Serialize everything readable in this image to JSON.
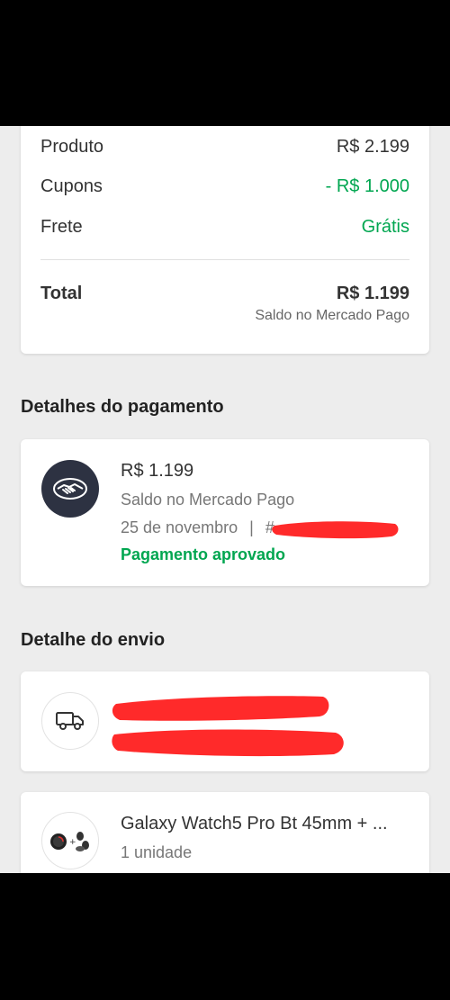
{
  "summary": {
    "product_label": "Produto",
    "product_value": "R$ 2.199",
    "coupons_label": "Cupons",
    "coupons_value": "- R$ 1.000",
    "shipping_label": "Frete",
    "shipping_value": "Grátis",
    "total_label": "Total",
    "total_value": "R$ 1.199",
    "total_note": "Saldo no Mercado Pago"
  },
  "payment": {
    "section_title": "Detalhes do pagamento",
    "amount": "R$ 1.199",
    "source": "Saldo no Mercado Pago",
    "date": "25 de novembro",
    "separator": "|",
    "id_prefix": "#",
    "status": "Pagamento aprovado",
    "logo_icon": "mercado-pago-handshake-icon",
    "status_color": "#00a650"
  },
  "shipping": {
    "section_title": "Detalhe do envio",
    "icon": "truck-icon"
  },
  "product": {
    "name": "Galaxy Watch5 Pro Bt 45mm + ...",
    "quantity": "1 unidade",
    "icon": "product-thumbnail"
  },
  "colors": {
    "accent_green": "#00a650",
    "redaction_red": "#ff2a2a",
    "logo_bg": "#2d3242"
  }
}
